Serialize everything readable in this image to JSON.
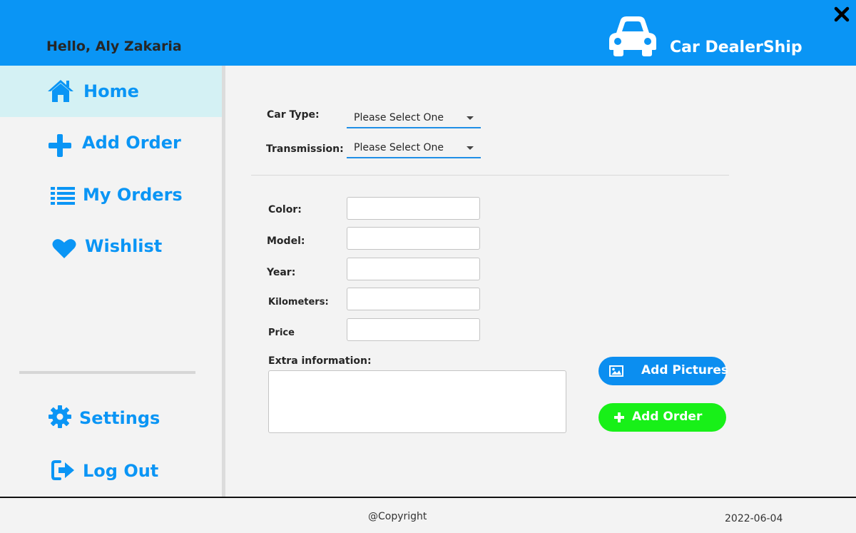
{
  "header": {
    "greeting": "Hello, Aly Zakaria",
    "brand_name": "Car DealerShip",
    "brand_icon": "car-icon",
    "close_icon": "close-icon"
  },
  "colors": {
    "accent": "#0a95f5",
    "active_nav_bg": "#d4f1f4",
    "add_order_button": "#18f018",
    "add_pictures_button": "#0b8ef0"
  },
  "sidebar": {
    "items": [
      {
        "label": "Home",
        "icon": "home-icon",
        "active": true
      },
      {
        "label": "Add Order",
        "icon": "plus-icon",
        "active": false
      },
      {
        "label": "My Orders",
        "icon": "list-icon",
        "active": false
      },
      {
        "label": "Wishlist",
        "icon": "heart-icon",
        "active": false
      }
    ],
    "bottom_items": [
      {
        "label": "Settings",
        "icon": "gear-icon"
      },
      {
        "label": "Log Out",
        "icon": "logout-icon"
      }
    ]
  },
  "form": {
    "car_type": {
      "label": "Car Type:",
      "value": "Please Select One"
    },
    "transmission": {
      "label": "Transmission:",
      "value": "Please Select One"
    },
    "color": {
      "label": "Color:",
      "value": ""
    },
    "model": {
      "label": "Model:",
      "value": ""
    },
    "year": {
      "label": "Year:",
      "value": ""
    },
    "kilometers": {
      "label": "Kilometers:",
      "value": ""
    },
    "price": {
      "label": "Price",
      "value": ""
    },
    "extra_info": {
      "label": "Extra information:",
      "value": ""
    },
    "add_pictures_label": "Add Pictures",
    "add_pictures_icon": "image-icon",
    "add_order_label": "Add Order",
    "add_order_icon": "plus-icon"
  },
  "footer": {
    "copyright": "@Copyright",
    "date": "2022-06-04"
  }
}
